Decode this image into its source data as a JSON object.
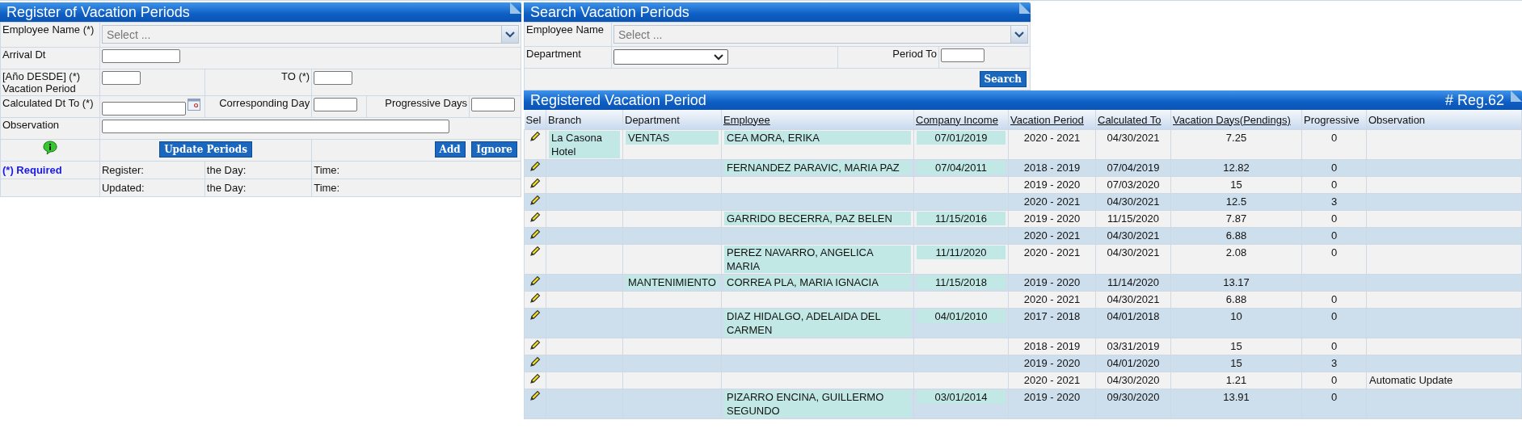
{
  "register": {
    "title": "Register of Vacation Periods",
    "employee_name": {
      "label": "Employee Name (*)",
      "placeholder": "Select ..."
    },
    "arrival": {
      "label": "Arrival Dt"
    },
    "period": {
      "label": "[Año DESDE] (*) Vacation Period",
      "to_label": "TO (*)"
    },
    "calculated": {
      "label": "Calculated Dt To (*)",
      "corresponding_label": "Corresponding Day",
      "progressive_label": "Progressive Days"
    },
    "observation": {
      "label": "Observation"
    },
    "buttons": {
      "update": "Update Periods",
      "add": "Add",
      "ignore": "Ignore"
    },
    "required": "(*) Required",
    "audit": [
      {
        "who": "Register:",
        "day": "the Day:",
        "time": "Time:"
      },
      {
        "who": "Updated:",
        "day": "the Day:",
        "time": "Time:"
      }
    ]
  },
  "search": {
    "title": "Search Vacation Periods",
    "employee_name": {
      "label": "Employee Name",
      "placeholder": "Select ..."
    },
    "department": {
      "label": "Department"
    },
    "period_to": {
      "label": "Period To"
    },
    "button": "Search"
  },
  "results": {
    "title": "Registered Vacation Period",
    "count": "# Reg.62",
    "columns": [
      {
        "label": "Sel",
        "sortable": false
      },
      {
        "label": "Branch",
        "sortable": false
      },
      {
        "label": "Department",
        "sortable": false
      },
      {
        "label": "Employee",
        "sortable": true
      },
      {
        "label": "Company Income",
        "sortable": true
      },
      {
        "label": "Vacation Period",
        "sortable": true
      },
      {
        "label": "Calculated To",
        "sortable": true
      },
      {
        "label": "Vacation Days(Pendings)",
        "sortable": true
      },
      {
        "label": "Progressive",
        "sortable": false
      },
      {
        "label": "Observation",
        "sortable": false
      }
    ],
    "rows": [
      {
        "branch": "La Casona Hotel",
        "department": "VENTAS",
        "employee": "CEA MORA, ERIKA",
        "income": "07/01/2019",
        "period": "2020 - 2021",
        "calculated": "04/30/2021",
        "days": "7.25",
        "progressive": "0",
        "observation": ""
      },
      {
        "branch": "",
        "department": "",
        "employee": "FERNANDEZ PARAVIC, MARIA PAZ",
        "income": "07/04/2011",
        "period": "2018 - 2019",
        "calculated": "07/04/2019",
        "days": "12.82",
        "progressive": "0",
        "observation": ""
      },
      {
        "branch": "",
        "department": "",
        "employee": "",
        "income": "",
        "period": "2019 - 2020",
        "calculated": "07/03/2020",
        "days": "15",
        "progressive": "0",
        "observation": ""
      },
      {
        "branch": "",
        "department": "",
        "employee": "",
        "income": "",
        "period": "2020 - 2021",
        "calculated": "04/30/2021",
        "days": "12.5",
        "progressive": "3",
        "observation": ""
      },
      {
        "branch": "",
        "department": "",
        "employee": "GARRIDO BECERRA, PAZ BELEN",
        "income": "11/15/2016",
        "period": "2019 - 2020",
        "calculated": "11/15/2020",
        "days": "7.87",
        "progressive": "0",
        "observation": ""
      },
      {
        "branch": "",
        "department": "",
        "employee": "",
        "income": "",
        "period": "2020 - 2021",
        "calculated": "04/30/2021",
        "days": "6.88",
        "progressive": "0",
        "observation": ""
      },
      {
        "branch": "",
        "department": "",
        "employee": "PEREZ NAVARRO, ANGELICA MARIA",
        "income": "11/11/2020",
        "period": "2020 - 2021",
        "calculated": "04/30/2021",
        "days": "2.08",
        "progressive": "0",
        "observation": ""
      },
      {
        "branch": "",
        "department": "MANTENIMIENTO",
        "employee": "CORREA PLA, MARIA IGNACIA",
        "income": "11/15/2018",
        "period": "2019 - 2020",
        "calculated": "11/14/2020",
        "days": "13.17",
        "progressive": "",
        "observation": ""
      },
      {
        "branch": "",
        "department": "",
        "employee": "",
        "income": "",
        "period": "2020 - 2021",
        "calculated": "04/30/2021",
        "days": "6.88",
        "progressive": "0",
        "observation": ""
      },
      {
        "branch": "",
        "department": "",
        "employee": "DIAZ HIDALGO, ADELAIDA DEL CARMEN",
        "income": "04/01/2010",
        "period": "2017 - 2018",
        "calculated": "04/01/2018",
        "days": "10",
        "progressive": "0",
        "observation": ""
      },
      {
        "branch": "",
        "department": "",
        "employee": "",
        "income": "",
        "period": "2018 - 2019",
        "calculated": "03/31/2019",
        "days": "15",
        "progressive": "0",
        "observation": ""
      },
      {
        "branch": "",
        "department": "",
        "employee": "",
        "income": "",
        "period": "2019 - 2020",
        "calculated": "04/01/2020",
        "days": "15",
        "progressive": "3",
        "observation": ""
      },
      {
        "branch": "",
        "department": "",
        "employee": "",
        "income": "",
        "period": "2020 - 2021",
        "calculated": "04/30/2020",
        "days": "1.21",
        "progressive": "0",
        "observation": "Automatic Update"
      },
      {
        "branch": "",
        "department": "",
        "employee": "PIZARRO ENCINA, GUILLERMO SEGUNDO",
        "income": "03/01/2014",
        "period": "2019 - 2020",
        "calculated": "09/30/2020",
        "days": "13.91",
        "progressive": "0",
        "observation": ""
      }
    ]
  }
}
